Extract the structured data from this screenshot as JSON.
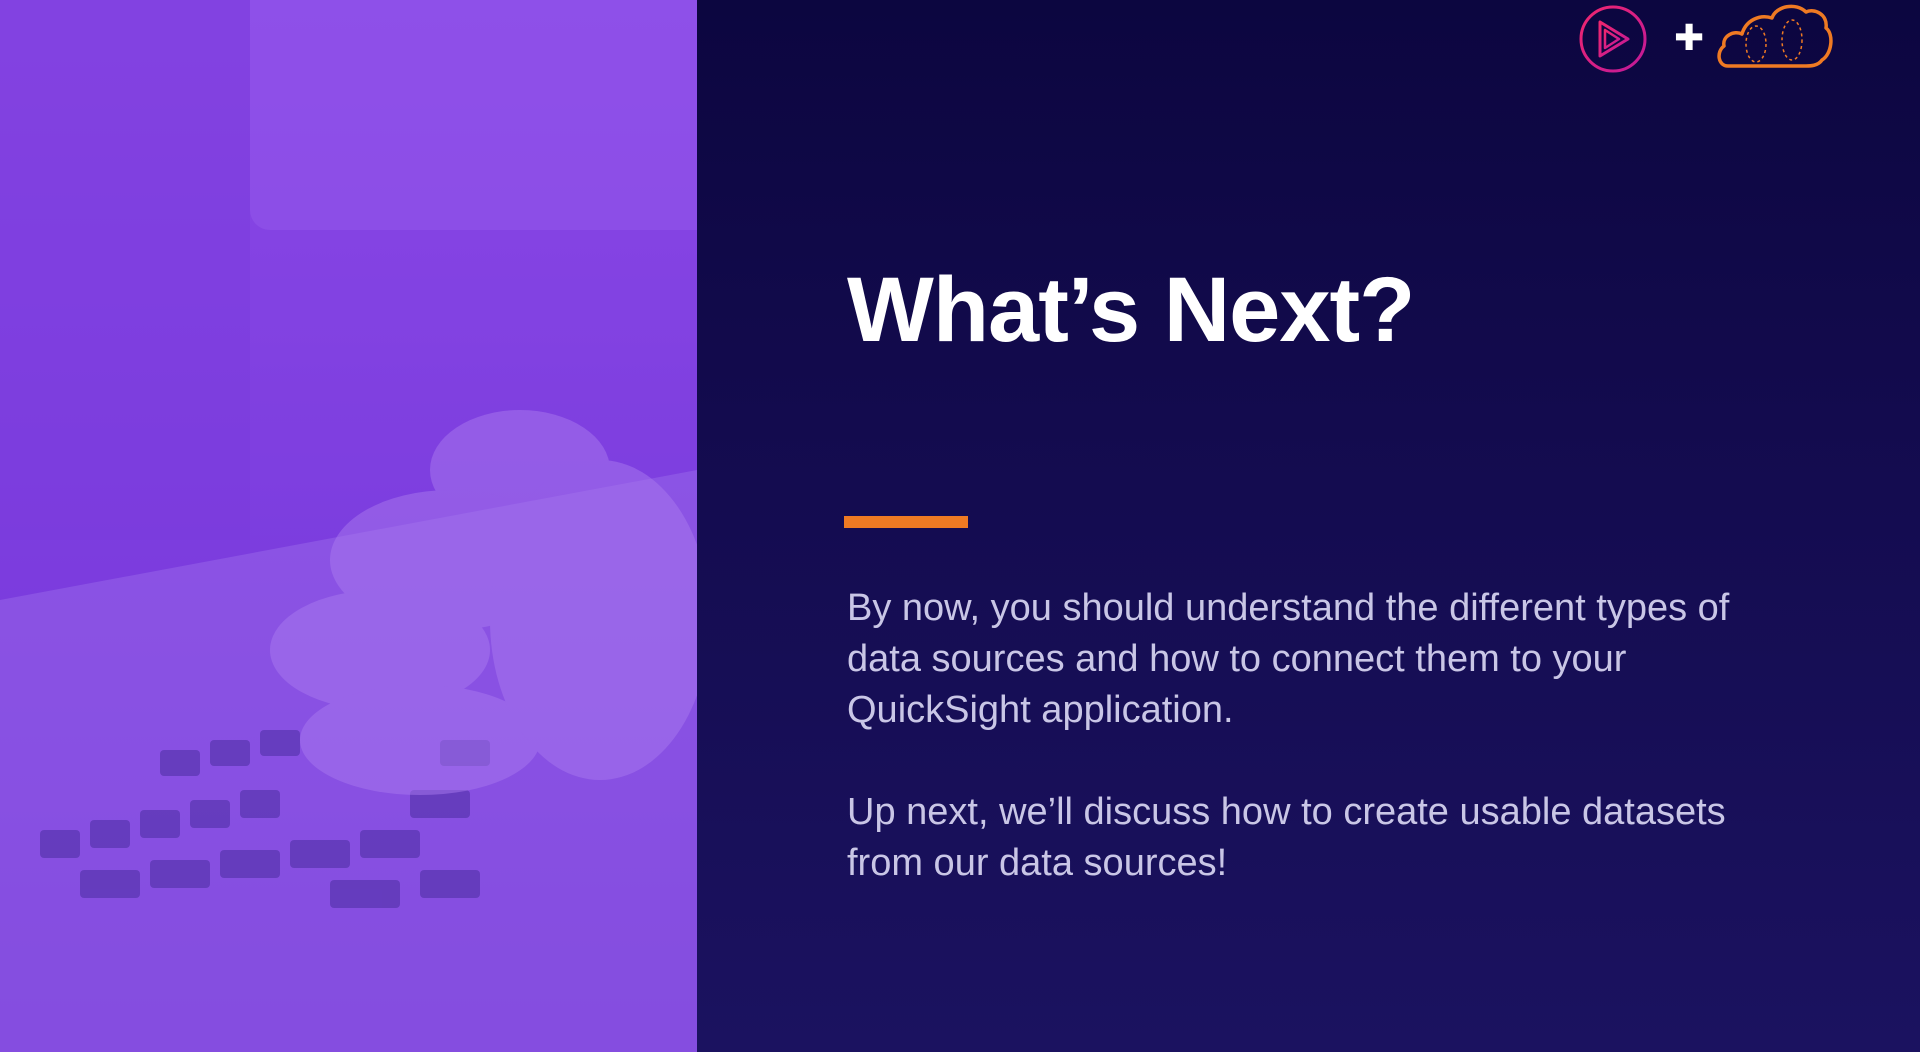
{
  "slide": {
    "title": "What’s Next?",
    "paragraphs": [
      "By now, you should understand the different types of data sources and how to connect them to your QuickSight application.",
      "Up next, we’ll discuss how to create usable datasets from our data sources!"
    ],
    "plus_symbol": "✚"
  },
  "icons": {
    "pluralsight": "pluralsight-play-icon",
    "cloud": "acloudguru-cloud-icon",
    "photo": "laptop-typing-photo"
  },
  "colors": {
    "accent": "#ef7a23",
    "background": "#120b44",
    "photo_tint": "#8048e0",
    "pluralsight_logo": "#e0245e",
    "cloud_logo": "#ef7a23"
  }
}
